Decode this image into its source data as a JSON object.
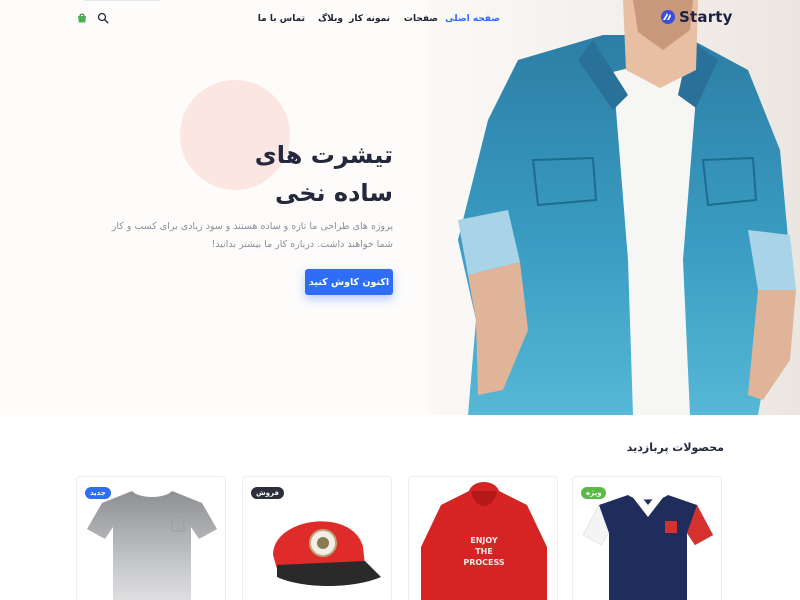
{
  "brand": {
    "name": "Starty"
  },
  "nav": {
    "items": [
      {
        "label": "صفحه اصلی",
        "active": true
      },
      {
        "label": "صفحات",
        "active": false
      },
      {
        "label": "نمونه کار",
        "active": false
      },
      {
        "label": "وبلاگ",
        "active": false
      },
      {
        "label": "تماس با ما",
        "active": false
      }
    ]
  },
  "header_icons": [
    "search-icon",
    "cart-icon"
  ],
  "hero": {
    "title_line1": "تیشرت های",
    "title_line2": "ساده نخی",
    "description": "پروژه های طراحی ما تازه و ساده هستند و سود زیادی برای کسب و کار شما خواهند داشت. درباره کار ما بیشتر بدانید!",
    "cta_label": "اکنون کاوش کنید"
  },
  "products": {
    "title": "محصولات پربازدید",
    "cards": [
      {
        "product": "tshirt-gray",
        "badge": "جدید",
        "badge_color": "#2f6df6"
      },
      {
        "product": "red-cap",
        "badge": "فروش",
        "badge_color": "#2b2f3a"
      },
      {
        "product": "red-hoodie",
        "badge": "",
        "badge_color": "",
        "print_text": "ENJOY THE PROCESS"
      },
      {
        "product": "navy-polo",
        "badge": "ویژه",
        "badge_color": "#5bb947"
      }
    ]
  },
  "colors": {
    "accent": "#2f6df6",
    "text": "#23283c",
    "muted": "#8a8f9c",
    "circle": "#fbe6e1"
  }
}
